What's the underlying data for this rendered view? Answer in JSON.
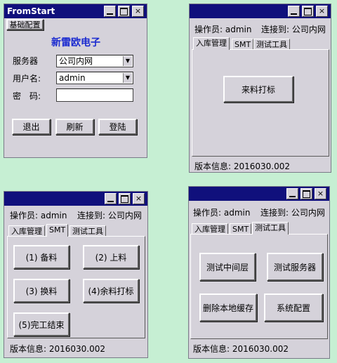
{
  "login": {
    "title": "FromStart",
    "config_button": "基础配置",
    "company": "新雷欧电子",
    "server_label": "服务器",
    "server_value": "公司内网",
    "user_label": "用户名:",
    "user_value": "admin",
    "password_label": "密　码:",
    "password_value": "",
    "exit_button": "退出",
    "refresh_button": "刷新",
    "login_button": "登陆"
  },
  "common": {
    "operator": "操作员: admin",
    "connected": "连接到: 公司内网",
    "tabs": [
      "入库管理",
      "SMT",
      "测试工具"
    ],
    "version": "版本信息: 2016030.002"
  },
  "inbound": {
    "incoming_button": "来料打标"
  },
  "smt": {
    "buttons": [
      "(1) 备料",
      "(2) 上料",
      "(3) 换料",
      "(4)余料打标",
      "(5)完工结束"
    ]
  },
  "tools": {
    "buttons": [
      "测试中间层",
      "测试服务器",
      "删除本地缓存",
      "系统配置"
    ]
  },
  "window_buttons": {
    "minimize": "_",
    "maximize": "□",
    "close": "×"
  },
  "colors": {
    "titlebar": "#10107c",
    "background": "#c6efd3",
    "window": "#d5d2da",
    "company": "#1a2ad0"
  }
}
